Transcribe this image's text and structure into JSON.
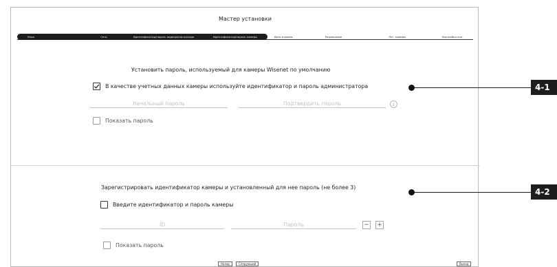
{
  "window": {
    "title": "Мастер установки"
  },
  "steps": [
    {
      "label": "Язык",
      "active": true
    },
    {
      "label": "Сеть",
      "active": true
    },
    {
      "label": "Идентификатор/пароль видеорегистратора",
      "active": true
    },
    {
      "label": "Идентификатор/пароль камеры",
      "active": true
    },
    {
      "label": "Дата и время",
      "active": false
    },
    {
      "label": "Разрешение",
      "active": false
    },
    {
      "label": "Рег. камеры",
      "active": false
    },
    {
      "label": "Настройка кан.",
      "active": false
    }
  ],
  "section1": {
    "heading": "Установить пароль, используемый для камеры Wisenet по умолчанию",
    "use_admin_checkbox": {
      "label": "В качестве учетных данных камеры используйте идентификатор и пароль администратора",
      "checked": true
    },
    "initial_password": {
      "placeholder": "Начальный пароль"
    },
    "confirm_password": {
      "placeholder": "Подтвердить пароль"
    },
    "info_icon_glyph": "i",
    "show_password": {
      "label": "Показать пароль",
      "checked": false
    }
  },
  "section2": {
    "heading": "Зарегистрировать идентификатор камеры и установленный для нее пароль (не более 3)",
    "enter_credentials_checkbox": {
      "label": "Введите идентификатор и пароль камеры",
      "checked": false
    },
    "id_field": {
      "placeholder": "ID"
    },
    "password_field": {
      "placeholder": "Пароль"
    },
    "minus_label": "−",
    "plus_label": "+",
    "show_password": {
      "label": "Показать пароль",
      "checked": false
    }
  },
  "footer": {
    "back_label": "Назад",
    "next_label": "Следующий",
    "exit_label": "Выход"
  },
  "callouts": [
    {
      "label": "4-1"
    },
    {
      "label": "4-2"
    }
  ],
  "colors": {
    "step_active_bg": "#1c1c1c",
    "callout_bg": "#1d1d1d",
    "placeholder_text": "#c3c3c3"
  }
}
